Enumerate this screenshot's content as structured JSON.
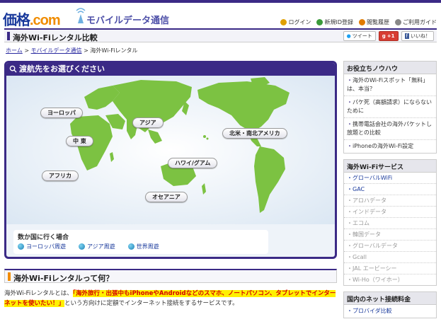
{
  "header": {
    "logo_main": "価格",
    "logo_dot": ".com",
    "logo_sub": "モバイルデータ通信",
    "utility": [
      {
        "label": "ログイン",
        "icon": "key-icon",
        "color": "#e0a000"
      },
      {
        "label": "新規ID登録",
        "icon": "user-add-icon",
        "color": "#3a9a3a"
      },
      {
        "label": "閲覧履歴",
        "icon": "history-icon",
        "color": "#e07a00"
      },
      {
        "label": "ご利用ガイド",
        "icon": "help-icon",
        "color": "#888888"
      }
    ]
  },
  "title_bar": {
    "title": "海外Wi-Fiレンタル比較",
    "tweet": "ツイート",
    "gplus": "+1",
    "like": "いいね！"
  },
  "breadcrumb": {
    "home": "ホーム",
    "sep": ">",
    "mobile": "モバイルデータ通信",
    "current": "海外Wi-Fiレンタル"
  },
  "map": {
    "heading": "渡航先をお選びください",
    "regions": [
      {
        "label": "ヨーロッパ"
      },
      {
        "label": "中 東"
      },
      {
        "label": "アジア"
      },
      {
        "label": "北米・南北アメリカ"
      },
      {
        "label": "ハワイ/グアム"
      },
      {
        "label": "アフリカ"
      },
      {
        "label": "オセアニア"
      }
    ],
    "multi_label": "数か国に行く場合",
    "multi_links": [
      "ヨーロッパ周遊",
      "アジア周遊",
      "世界周遊"
    ]
  },
  "about": {
    "title": "海外Wi-Fiレンタルって何？",
    "text_prefix": "海外Wi-Fiレンタルとは、",
    "text_highlight": "「海外旅行・出張中もiPhoneやAndroidなどのスマホ、ノートパソコン、タブレットでインターネットを使いたい！」",
    "text_suffix": "という方向けに定額でインターネット接続をするサービスです。"
  },
  "sidebar": {
    "knowhow_title": "お役立ちノウハウ",
    "knowhow": [
      "海外のWi-Fiスポット「無料」は、本当？",
      "パケ死（高額請求）にならないために",
      "携帯電話会社の海外パケットし放題との比較",
      "iPhoneの海外Wi-Fi設定"
    ],
    "services_title": "海外Wi-Fiサービス",
    "services": [
      {
        "label": "グローバルWiFi",
        "state": "active"
      },
      {
        "label": "GAC",
        "state": "active"
      },
      {
        "label": "アロハデータ",
        "state": "dim"
      },
      {
        "label": "インドデータ",
        "state": "dim"
      },
      {
        "label": "エコム",
        "state": "dim"
      },
      {
        "label": "韓国データ",
        "state": "dim"
      },
      {
        "label": "グローバルデータ",
        "state": "dim"
      },
      {
        "label": "Gcall",
        "state": "dim"
      },
      {
        "label": "JAL エービーシー",
        "state": "dim"
      },
      {
        "label": "Wi-Ho（ワイホー）",
        "state": "dim"
      }
    ],
    "net_title": "国内のネット接続料金",
    "net": [
      "プロバイダ比較"
    ]
  },
  "colors": {
    "brand": "#3b2a86",
    "map_land": "#7cc242",
    "map_sea": "#eef3f9",
    "highlight": "#fff000"
  }
}
